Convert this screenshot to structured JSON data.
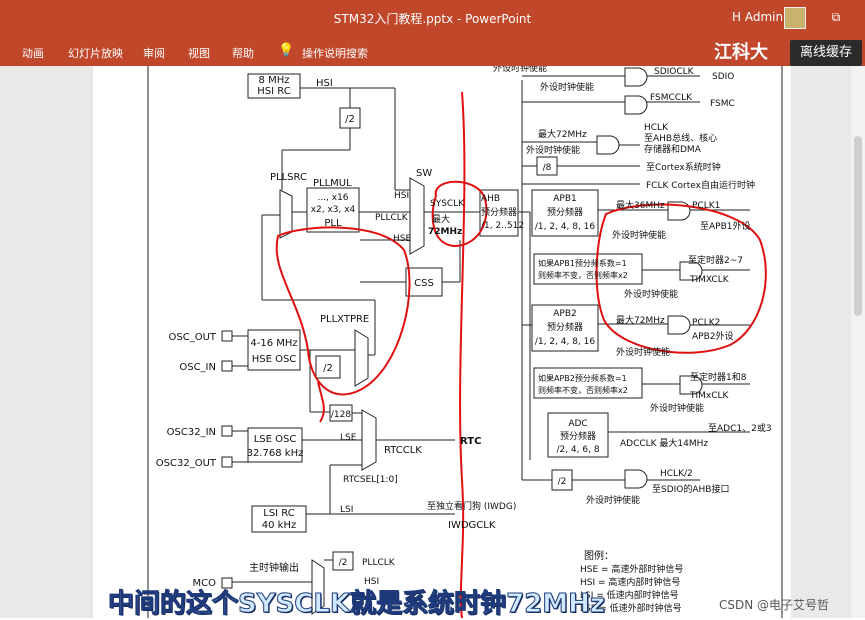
{
  "window": {
    "title": "STM32入门教程.pptx  -  PowerPoint",
    "user": "H Admin",
    "icon_restore": "restore-icon"
  },
  "ribbon": {
    "tabs": [
      "动画",
      "幻灯片放映",
      "审阅",
      "视图",
      "帮助"
    ],
    "tell_me": "操作说明搜索",
    "tell_me_icon": "lightbulb-icon"
  },
  "overlay": {
    "brand": "江科大",
    "cache_button": "离线缓存",
    "caption": "中间的这个SYSCLK就是系统时钟72MHz",
    "watermark": "CSDN @电子艾号哲"
  },
  "diagram": {
    "hsi_rc": [
      "8 MHz",
      "HSI RC"
    ],
    "hsi": "HSI",
    "div2": "/2",
    "pllsrc": "PLLSRC",
    "pllmul": "PLLMUL",
    "pll_box": [
      "..., x16",
      "x2, x3, x4",
      "PLL"
    ],
    "sw": "SW",
    "sys_hsi": "HSI",
    "pllclk": "PLLCLK",
    "hse": "HSE",
    "sysclk": "SYSCLK",
    "sysclk_max": [
      "最大",
      "72MHz"
    ],
    "ahb_box": [
      "AHB",
      "预分频器",
      "/1, 2..512"
    ],
    "css": "CSS",
    "pllxtpre": "PLLXTPRE",
    "pllxtpre_div2": "/2",
    "osc_out": "OSC_OUT",
    "osc_in": "OSC_IN",
    "hse_osc": [
      "4-16 MHz",
      "HSE OSC"
    ],
    "div128": "/128",
    "osc32_in": "OSC32_IN",
    "osc32_out": "OSC32_OUT",
    "lse_osc": [
      "LSE OSC",
      "32.768 kHz"
    ],
    "lse": "LSE",
    "rtcclk": "RTCCLK",
    "rtc": "RTC",
    "rtcsel": "RTCSEL[1:0]",
    "iwdg_note": "至独立看门狗 (IWDG)",
    "lsi_rc": [
      "LSI RC",
      "40 kHz"
    ],
    "lsi": "LSI",
    "iwdgclk": "IWDGCLK",
    "mco_title": "主时钟输出",
    "mco": "MCO",
    "mco_div2": "/2",
    "mco_pllclk": "PLLCLK",
    "mco_hsi": "HSI",
    "top_enable": "外设时钟使能",
    "sdioclk": "SDIOCLK",
    "sdio": "SDIO",
    "enable_1": "外设时钟使能",
    "fsmcclk": "FSMCCLK",
    "fsmc": "FSMC",
    "max72_1": "最大72MHz",
    "hclk": "HCLK",
    "hclk_desc1": "至AHB总线、核心",
    "hclk_desc2": "存储器和DMA",
    "enable_2": "外设时钟使能",
    "div8": "/8",
    "cortex_timer": "至Cortex系统时钟",
    "fclk": "FCLK Cortex自由运行时钟",
    "apb1_box": [
      "APB1",
      "预分频器",
      "/1, 2, 4, 8, 16"
    ],
    "max36": "最大36MHz",
    "pclk1": "PCLK1",
    "apb1_dest": "至APB1外设",
    "enable_3": "外设时钟使能",
    "apb1_note": [
      "如果APB1预分频系数=1",
      "则频率不变，否则频率x2"
    ],
    "timer27": "至定时器2~7",
    "timxclk1": "TIMXCLK",
    "enable_4": "外设时钟使能",
    "apb2_box": [
      "APB2",
      "预分频器",
      "/1, 2, 4, 8, 16"
    ],
    "max72_2": "最大72MHz",
    "pclk2": "PCLK2",
    "apb2_dest": "APB2外设",
    "enable_5": "外设时钟使能",
    "apb2_note": [
      "如果APB2预分频系数=1",
      "则频率不变，否则频率x2"
    ],
    "timer18": "至定时器1和8",
    "timxclk2": "TIMxCLK",
    "enable_6": "外设时钟使能",
    "adc_box": [
      "ADC",
      "预分频器",
      "/2, 4, 6, 8"
    ],
    "adc_dest": "至ADC1、2或3",
    "adcclk": "ADCCLK 最大14MHz",
    "hclk2_div": "/2",
    "hclk2": "HCLK/2",
    "sdio_ahb": "至SDIO的AHB接口",
    "enable_7": "外设时钟使能",
    "legend_title": "图例：",
    "legend_hse": "HSE = 高速外部时钟信号",
    "legend_hsi": "HSI = 高速内部时钟信号",
    "legend_lsi": "LSI = 低速内部时钟信号",
    "legend_lse": "LSE = 低速外部时钟信号"
  }
}
